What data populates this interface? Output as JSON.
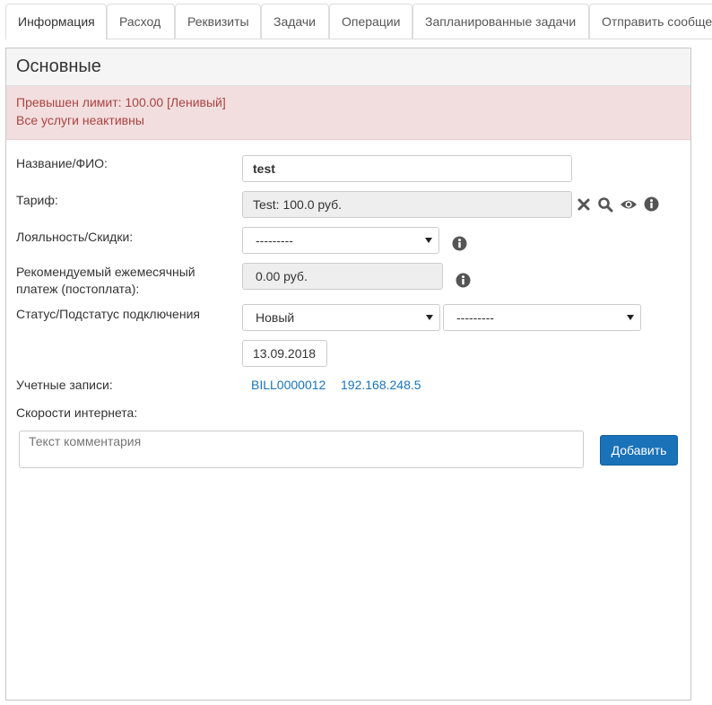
{
  "tabs": [
    {
      "label": "Информация",
      "active": true
    },
    {
      "label": "Расход",
      "active": false
    },
    {
      "label": "Реквизиты",
      "active": false
    },
    {
      "label": "Задачи",
      "active": false
    },
    {
      "label": "Операции",
      "active": false
    },
    {
      "label": "Запланированные задачи",
      "active": false
    },
    {
      "label": "Отправить сообще",
      "active": false
    }
  ],
  "panel": {
    "title": "Основные",
    "alert": {
      "line1": "Превышен лимит: 100.00 [Ленивый]",
      "line2": "Все услуги неактивны"
    }
  },
  "form": {
    "name": {
      "label": "Название/ФИО:",
      "value": "test"
    },
    "tariff": {
      "label": "Тариф:",
      "value": "Test: 100.0 руб.",
      "icons": [
        "close-icon",
        "search-icon",
        "eye-icon",
        "info-icon"
      ]
    },
    "loyalty": {
      "label": "Лояльность/Скидки:",
      "selected": "---------",
      "icon": "info-icon"
    },
    "payment": {
      "label_line1": "Рекомендуемый ежемесячный",
      "label_line2": "платеж (постоплата):",
      "value": "0.00 руб.",
      "icon": "info-icon"
    },
    "status": {
      "label": "Статус/Подстатус подключения",
      "status_selected": "Новый",
      "substatus_selected": "---------",
      "date": "13.09.2018"
    },
    "accounts": {
      "label": "Учетные записи:",
      "links": [
        "BILL0000012",
        "192.168.248.5"
      ]
    },
    "speeds": {
      "label": "Скорости интернета:"
    },
    "comment": {
      "placeholder": "Текст комментария",
      "button": "Добавить"
    }
  },
  "colors": {
    "primary": "#1a72b9",
    "link": "#1b74b9",
    "alert_bg": "#f2dede",
    "alert_text": "#a94442",
    "readonly_bg": "#eeeeee"
  }
}
